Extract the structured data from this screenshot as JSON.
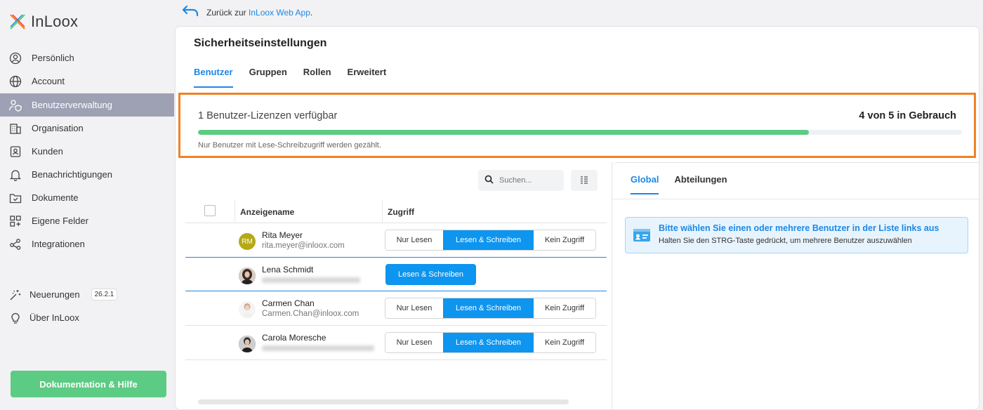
{
  "sidebar": {
    "logo_text": "InLoox",
    "items": [
      {
        "label": "Persönlich",
        "icon": "person-circle-icon"
      },
      {
        "label": "Account",
        "icon": "globe-icon"
      },
      {
        "label": "Benutzerverwaltung",
        "icon": "user-shield-icon"
      },
      {
        "label": "Organisation",
        "icon": "building-icon"
      },
      {
        "label": "Kunden",
        "icon": "contact-card-icon"
      },
      {
        "label": "Benachrichtigungen",
        "icon": "bell-icon"
      },
      {
        "label": "Dokumente",
        "icon": "folder-check-icon"
      },
      {
        "label": "Eigene Felder",
        "icon": "grid-add-icon"
      },
      {
        "label": "Integrationen",
        "icon": "share-nodes-icon"
      }
    ],
    "news_label": "Neuerungen",
    "version_badge": "26.2.1",
    "about_label": "Über InLoox",
    "doc_button": "Dokumentation & Hilfe"
  },
  "back": {
    "prefix": "Zurück zur",
    "link": "InLoox Web App",
    "suffix": "."
  },
  "main": {
    "title": "Sicherheitseinstellungen",
    "tabs": [
      "Benutzer",
      "Gruppen",
      "Rollen",
      "Erweitert"
    ],
    "license": {
      "available_text": "1 Benutzer-Lizenzen verfügbar",
      "usage_text": "4 von 5 in Gebrauch",
      "used_fraction": 0.8,
      "note": "Nur Benutzer mit Lese-Schreibzugriff werden gezählt."
    },
    "search_placeholder": "Suchen...",
    "columns": [
      "Anzeigename",
      "Zugriff"
    ],
    "access_options": [
      "Nur Lesen",
      "Lesen & Schreiben",
      "Kein Zugriff"
    ],
    "users": [
      {
        "name": "Rita Meyer",
        "email": "rita.meyer@inloox.com",
        "initials": "RM",
        "access": "Lesen & Schreiben"
      },
      {
        "name": "Lena Schmidt",
        "email": "",
        "initials": "",
        "access": "Lesen & Schreiben"
      },
      {
        "name": "Carmen Chan",
        "email": "Carmen.Chan@inloox.com",
        "initials": "",
        "access": "Lesen & Schreiben"
      },
      {
        "name": "Carola Moresche",
        "email": "",
        "initials": "",
        "access": "Lesen & Schreiben"
      }
    ]
  },
  "right_panel": {
    "tabs": [
      "Global",
      "Abteilungen"
    ],
    "info_title": "Bitte wählen Sie einen oder mehrere Benutzer in der Liste links aus",
    "info_text": "Halten Sie den STRG-Taste gedrückt, um mehrere Benutzer auszuwählen"
  },
  "colors": {
    "accent": "#1e88e5",
    "active_button": "#0d95ef",
    "success": "#5ccb83",
    "highlight_border": "#f08226",
    "sidebar_active": "#9ea1b4"
  }
}
